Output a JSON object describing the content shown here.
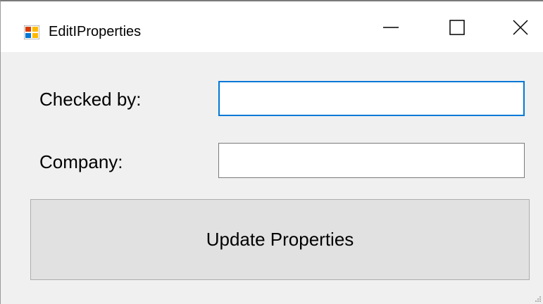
{
  "window": {
    "title": "EditIProperties",
    "app_icon": "form-app-icon",
    "controls": {
      "minimize_icon": "minimize-icon",
      "maximize_icon": "maximize-icon",
      "close_icon": "close-icon"
    }
  },
  "form": {
    "checked_by": {
      "label": "Checked by:",
      "value": "",
      "focused": true
    },
    "company": {
      "label": "Company:",
      "value": "",
      "focused": false
    },
    "update_button": {
      "label": "Update Properties"
    }
  },
  "colors": {
    "focus_border": "#0078d7",
    "button_face": "#e1e1e1",
    "window_bg": "#f0f0f0",
    "titlebar_bg": "#ffffff"
  }
}
